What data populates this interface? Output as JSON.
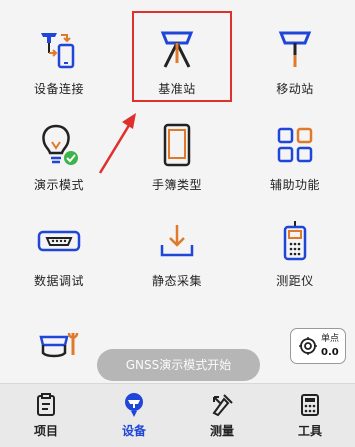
{
  "grid": {
    "items": [
      {
        "label": "设备连接",
        "icon": "device-connect-icon"
      },
      {
        "label": "基准站",
        "icon": "base-station-icon"
      },
      {
        "label": "移动站",
        "icon": "rover-icon"
      },
      {
        "label": "演示模式",
        "icon": "demo-mode-icon"
      },
      {
        "label": "手簿类型",
        "icon": "handbook-icon"
      },
      {
        "label": "辅助功能",
        "icon": "grid-icon"
      },
      {
        "label": "数据调试",
        "icon": "serial-port-icon"
      },
      {
        "label": "静态采集",
        "icon": "download-icon"
      },
      {
        "label": "测距仪",
        "icon": "rangefinder-icon"
      },
      {
        "label": "",
        "icon": "instrument-settings-icon"
      }
    ]
  },
  "toast": {
    "text": "GNSS演示模式开始"
  },
  "single_point": {
    "label": "单点",
    "value": "0.0"
  },
  "bottom_nav": {
    "items": [
      {
        "label": "项目",
        "icon": "project-icon"
      },
      {
        "label": "设备",
        "icon": "device-icon"
      },
      {
        "label": "测量",
        "icon": "survey-icon"
      },
      {
        "label": "工具",
        "icon": "tools-icon"
      }
    ],
    "active": "设备"
  },
  "colors": {
    "accent_blue": "#1f46d8",
    "highlight_red": "#e0302e",
    "check_green": "#3bb54a"
  }
}
